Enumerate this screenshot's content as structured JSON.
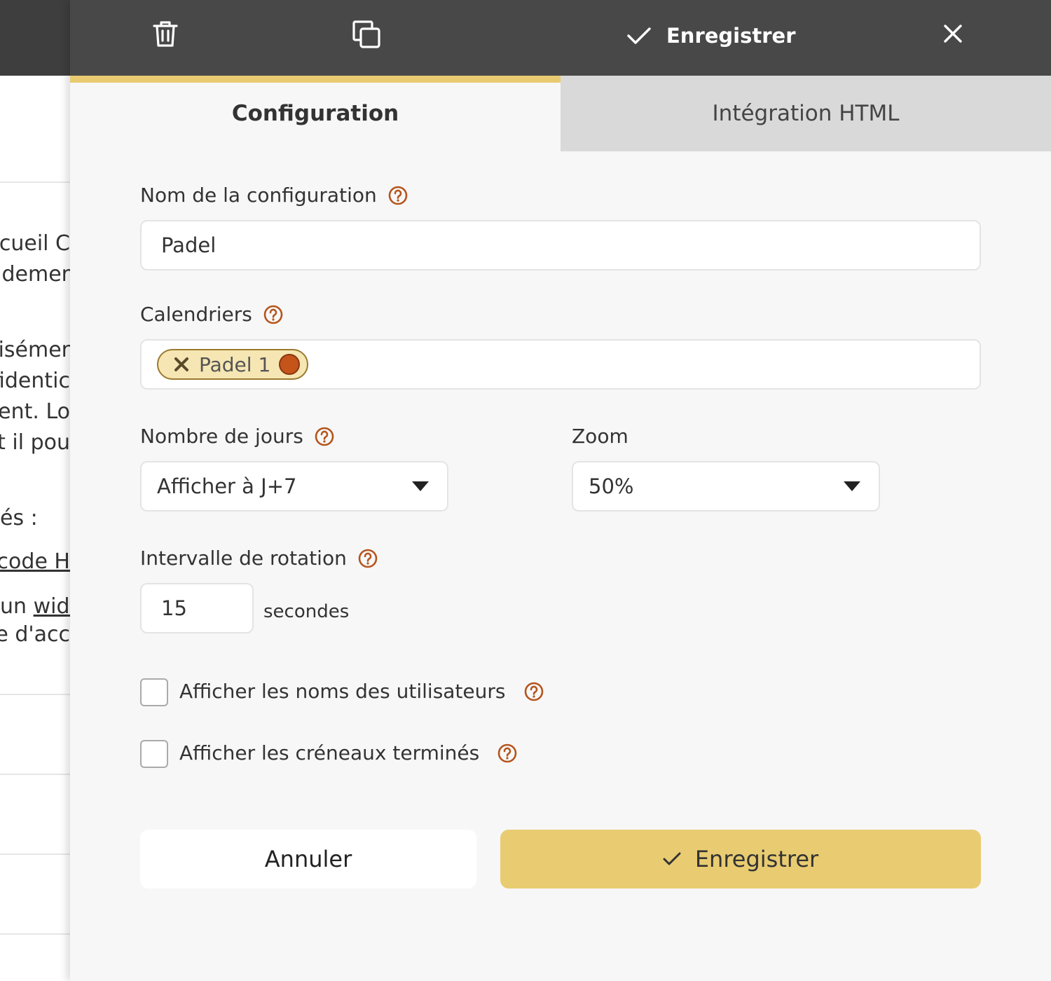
{
  "background": {
    "lines": [
      "ccueil C",
      "oidemer",
      "isémer",
      "fidentic",
      "nent. Lo",
      "et il pou",
      "és :",
      "code H",
      "un",
      "widg",
      "ue d'acc"
    ]
  },
  "toolbar": {
    "delete_icon": "trash-icon",
    "duplicate_icon": "copy-icon",
    "save_label": "Enregistrer",
    "close_icon": "close-icon"
  },
  "tabs": [
    {
      "label": "Configuration",
      "active": true
    },
    {
      "label": "Intégration HTML",
      "active": false
    }
  ],
  "form": {
    "config_name": {
      "label": "Nom de la configuration",
      "value": "Padel"
    },
    "calendars": {
      "label": "Calendriers",
      "chips": [
        {
          "label": "Padel 1",
          "color": "#c4541a"
        }
      ]
    },
    "days": {
      "label": "Nombre de jours",
      "value": "Afficher à J+7"
    },
    "zoom": {
      "label": "Zoom",
      "value": "50%"
    },
    "rotation": {
      "label": "Intervalle de rotation",
      "value": "15",
      "unit": "secondes"
    },
    "show_names": {
      "label": "Afficher les noms des utilisateurs",
      "checked": false
    },
    "show_finished": {
      "label": "Afficher les créneaux terminés",
      "checked": false
    }
  },
  "actions": {
    "cancel_label": "Annuler",
    "save_label": "Enregistrer"
  },
  "colors": {
    "accent": "#e9cc72",
    "help": "#b5541b",
    "topbar": "#484848"
  }
}
